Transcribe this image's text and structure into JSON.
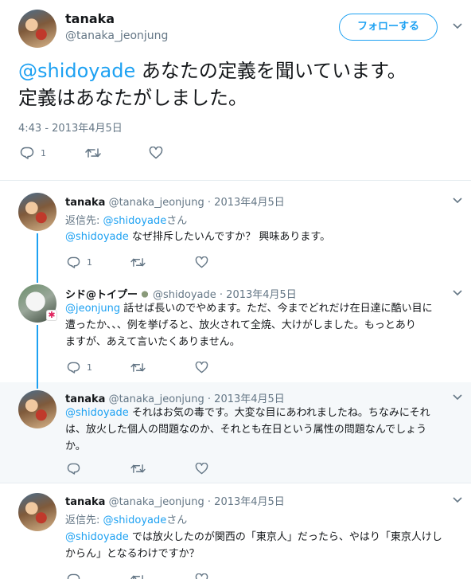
{
  "main": {
    "name": "tanaka",
    "handle": "@tanaka_jeonjung",
    "follow_label": "フォローする",
    "mention": "@shidoyade",
    "text_line1_rest": " あなたの定義を聞いています。",
    "text_line2": "定義はあなたがしました。",
    "timestamp": "4:43 - 2013年4月5日",
    "reply_count": "1"
  },
  "replies": [
    {
      "name": "tanaka",
      "handle": "@tanaka_jeonjung",
      "sep": " · ",
      "date": "2013年4月5日",
      "reply_to_prefix": "返信先: ",
      "reply_to_handle": "@shidoyade",
      "reply_to_suffix": "さん",
      "mention": "@shidoyade",
      "text": " なぜ排斥したいんですか？ 興味あります。",
      "reply_count": "1"
    },
    {
      "name": "シド@トイプー",
      "handle": "@shidoyade",
      "sep": " · ",
      "date": "2013年4月5日",
      "mention": "@jeonjung",
      "text_l1": " 話せば長いのでやめます。ただ、今までどれだけ在日達に酷い目に",
      "text_l2": "遭ったか、、、例を挙げると、放火されて全焼、大けがしました。もっとあり",
      "text_l3": "ますが、あえて言いたくありません。",
      "reply_count": "1"
    },
    {
      "name": "tanaka",
      "handle": "@tanaka_jeonjung",
      "sep": " · ",
      "date": "2013年4月5日",
      "mention": "@shidoyade",
      "text_l1": " それはお気の毒です。大変な目にあわれましたね。ちなみにそれ",
      "text_l2": "は、放火した個人の問題なのか、それとも在日という属性の問題なんでしょう",
      "text_l3": "か。"
    },
    {
      "name": "tanaka",
      "handle": "@tanaka_jeonjung",
      "sep": " · ",
      "date": "2013年4月5日",
      "reply_to_prefix": "返信先: ",
      "reply_to_handle": "@shidoyade",
      "reply_to_suffix": "さん",
      "mention": "@shidoyade",
      "text_l1": " では放火したのが関西の「東京人」だったら、やはり「東京人けし",
      "text_l2": "からん」となるわけですか？"
    }
  ],
  "icons": {
    "reply": "reply-icon",
    "retweet": "retweet-icon",
    "like": "like-icon",
    "more": "chevron-down-icon"
  },
  "colors": {
    "accent": "#1da1f2",
    "secondary_text": "#657786",
    "highlight_bg": "#f5f8fa"
  }
}
